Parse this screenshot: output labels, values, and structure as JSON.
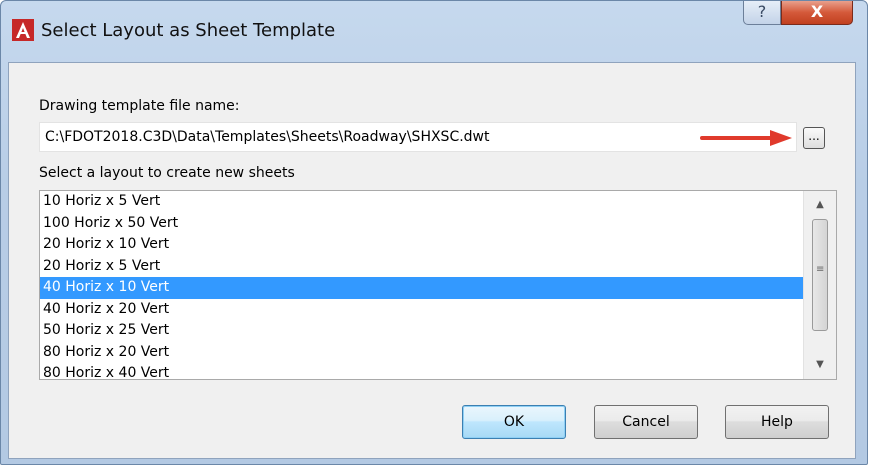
{
  "window": {
    "title": "Select Layout as Sheet Template",
    "help_glyph": "?",
    "close_glyph": "X"
  },
  "template": {
    "label": "Drawing template file name:",
    "path": "C:\\FDOT2018.C3D\\Data\\Templates\\Sheets\\Roadway\\SHXSC.dwt",
    "browse_label": "..."
  },
  "layouts": {
    "label": "Select a layout to create new sheets",
    "items": [
      {
        "label": "10 Horiz x 5 Vert",
        "selected": false
      },
      {
        "label": "100 Horiz x 50 Vert",
        "selected": false
      },
      {
        "label": "20 Horiz x 10 Vert",
        "selected": false
      },
      {
        "label": "20 Horiz x 5 Vert",
        "selected": false
      },
      {
        "label": "40 Horiz x 10 Vert",
        "selected": true
      },
      {
        "label": "40 Horiz x 20 Vert",
        "selected": false
      },
      {
        "label": "50 Horiz x 25 Vert",
        "selected": false
      },
      {
        "label": "80 Horiz x 20 Vert",
        "selected": false
      },
      {
        "label": "80 Horiz x 40 Vert",
        "selected": false
      }
    ]
  },
  "buttons": {
    "ok": "OK",
    "cancel": "Cancel",
    "help": "Help"
  },
  "colors": {
    "selection": "#3399ff",
    "annotation_arrow": "#e03a2c"
  }
}
